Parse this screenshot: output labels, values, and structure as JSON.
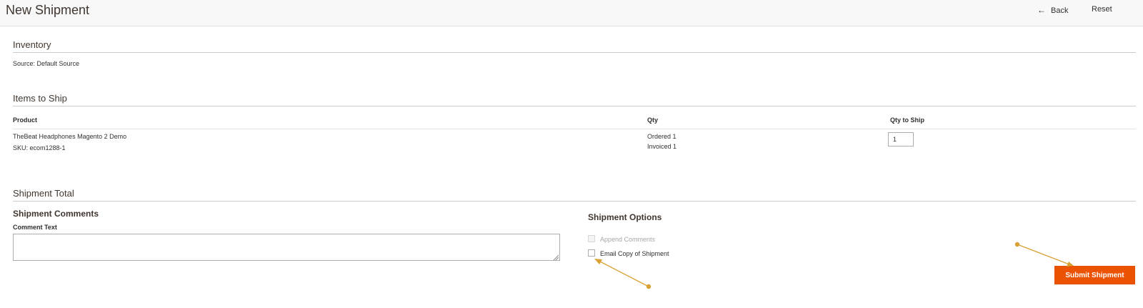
{
  "header": {
    "title": "New Shipment",
    "back_label": "Back",
    "reset_label": "Reset"
  },
  "inventory": {
    "title": "Inventory",
    "source_text": "Source: Default Source"
  },
  "items": {
    "title": "Items to Ship",
    "columns": [
      "Product",
      "Qty",
      "Qty to Ship"
    ],
    "rows": [
      {
        "product": "TheBeat Headphones Magento 2 Demo",
        "sku": "SKU: ecom1288-1",
        "ordered": "Ordered 1",
        "invoiced": "Invoiced 1",
        "qty_to_ship": "1"
      }
    ]
  },
  "total": {
    "title": "Shipment Total",
    "comments_title": "Shipment Comments",
    "comment_label": "Comment Text",
    "comment_value": "",
    "options_title": "Shipment Options",
    "append_label": "Append Comments",
    "email_label": "Email Copy of Shipment",
    "submit_label": "Submit Shipment"
  },
  "colors": {
    "accent": "#eb5202",
    "annotation": "#d9a035"
  },
  "icons": {
    "back": "arrow-left-icon",
    "resize": "resize-grip-icon"
  }
}
